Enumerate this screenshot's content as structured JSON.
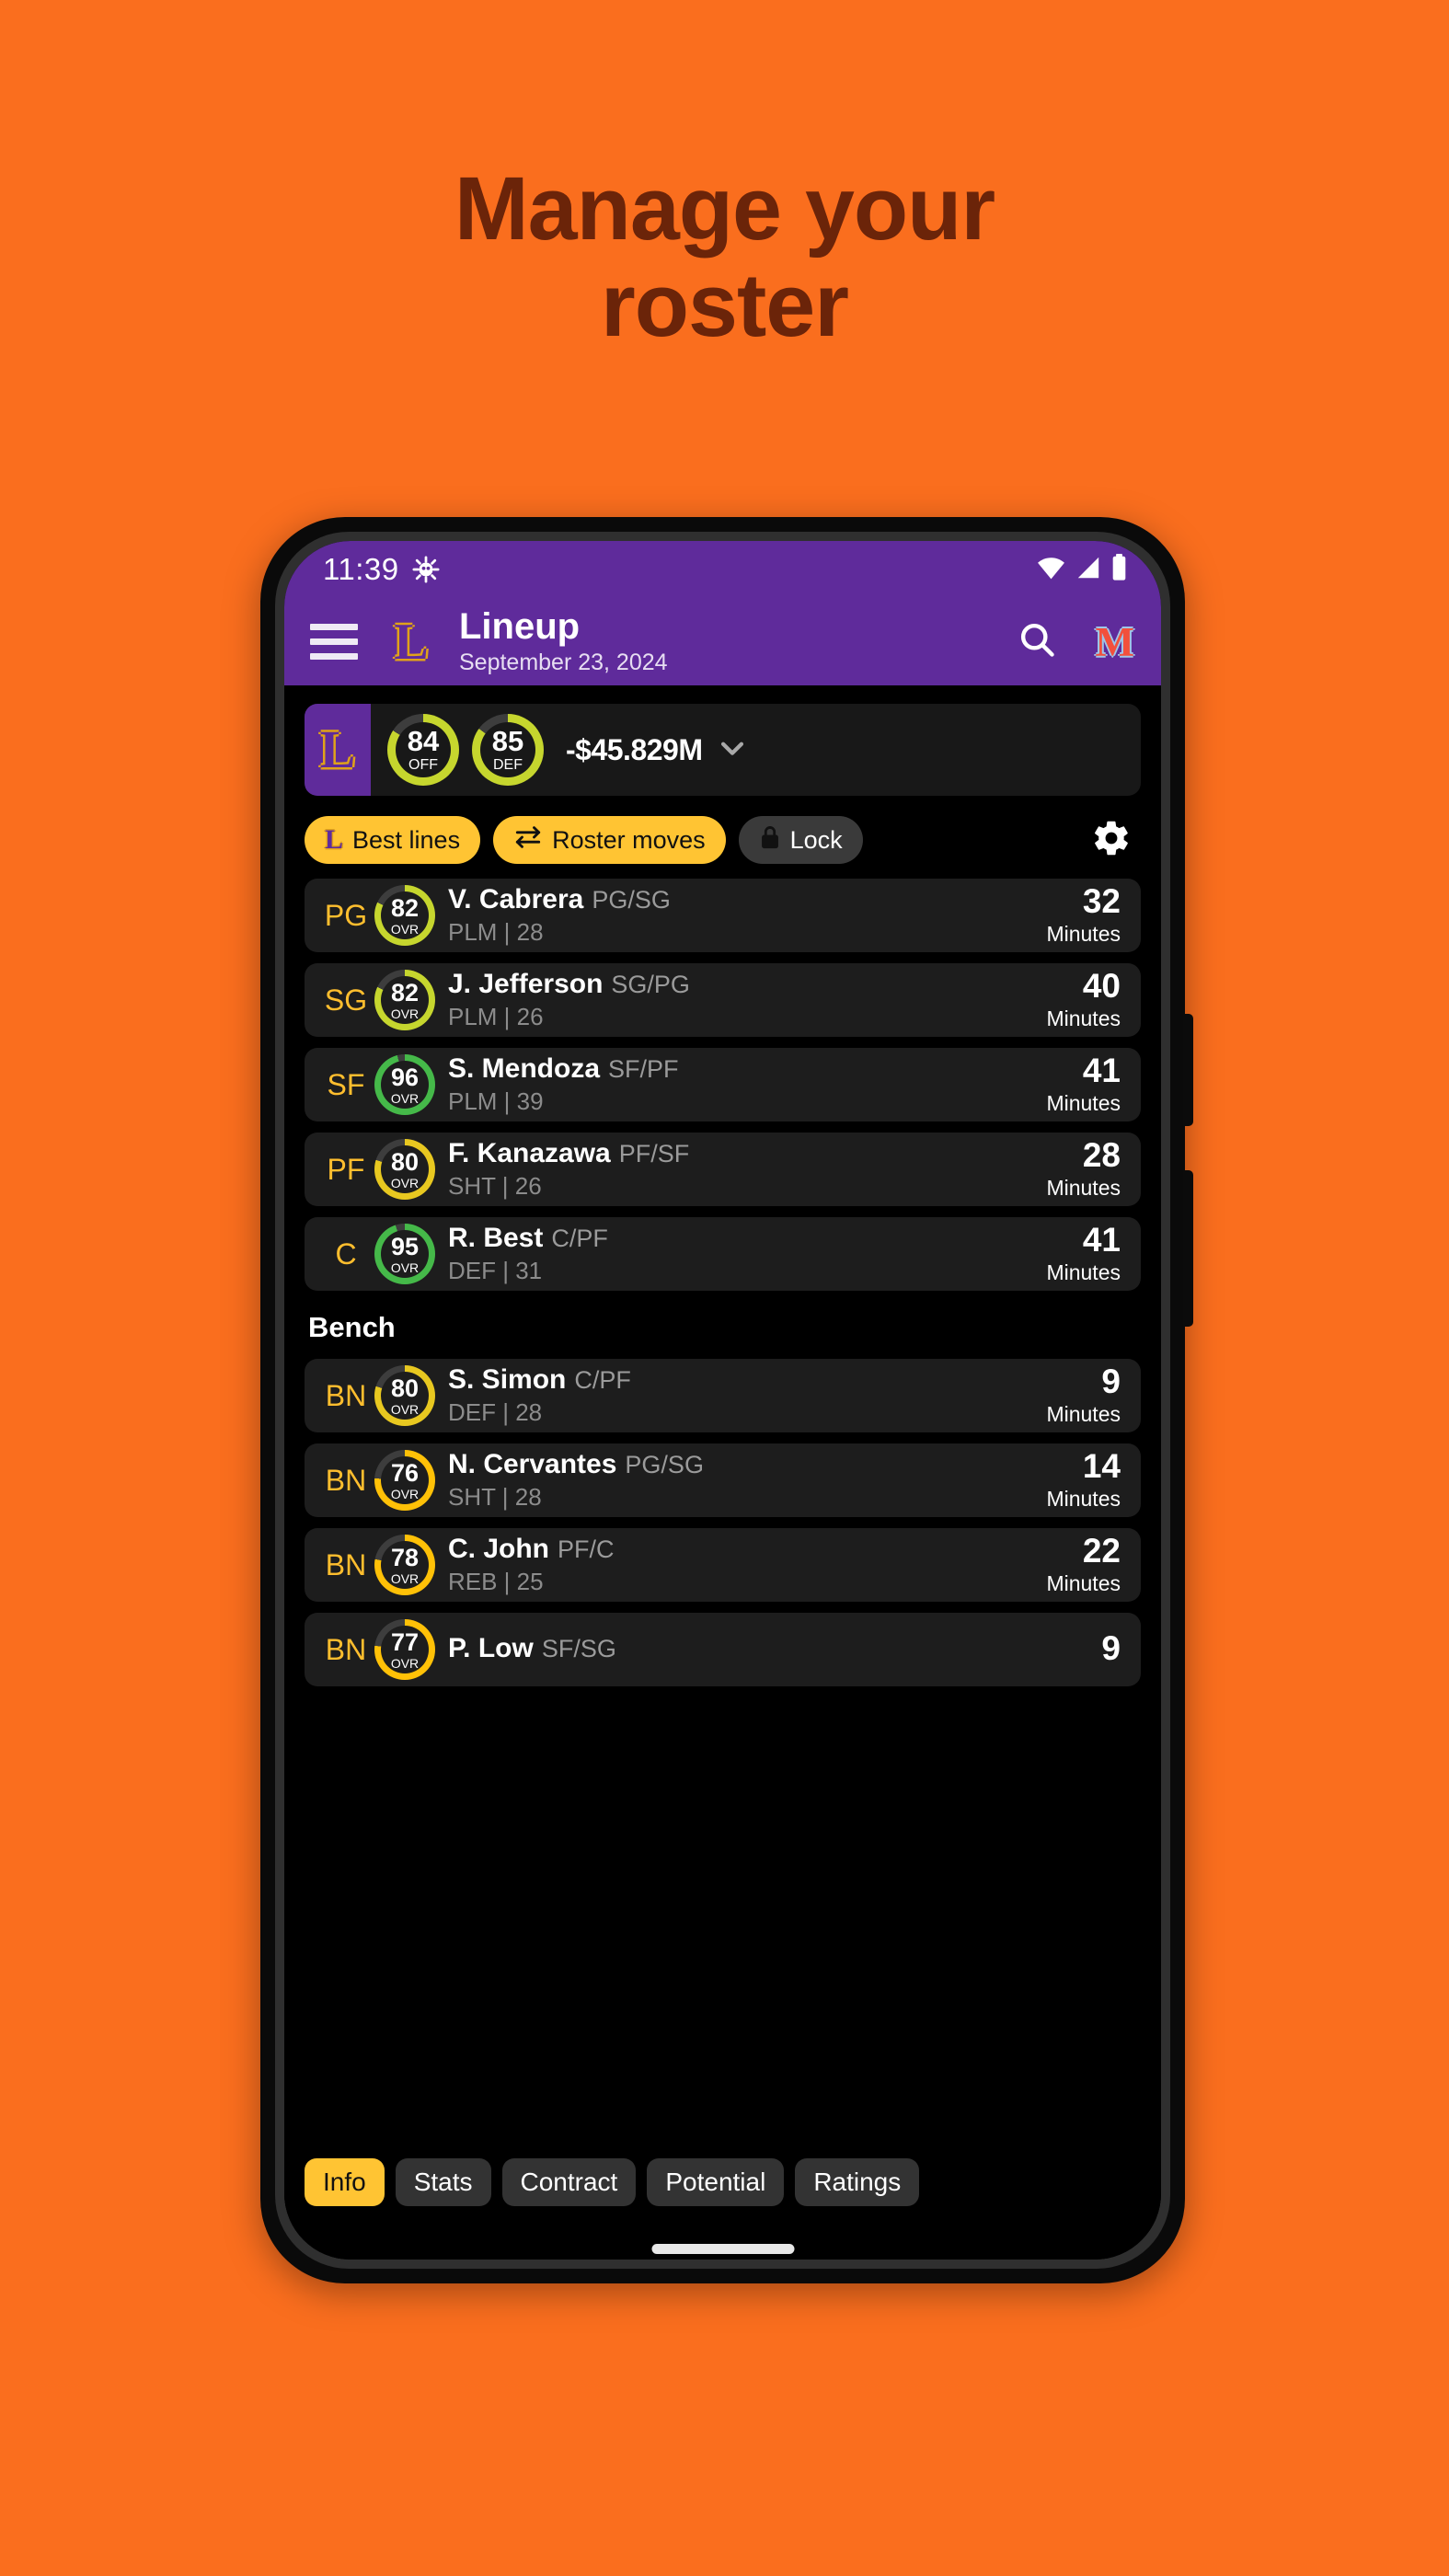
{
  "promo": {
    "headline_line1": "Manage your",
    "headline_line2": "roster",
    "bg_color": "#fa6e1e",
    "text_color": "#6b2409"
  },
  "status_bar": {
    "time": "11:39",
    "icons": [
      "bug-icon",
      "wifi-icon",
      "cellular-signal-icon",
      "battery-icon"
    ]
  },
  "app_bar": {
    "menu_icon": "hamburger-menu-icon",
    "team_logo": "L",
    "title": "Lineup",
    "subtitle": "September 23, 2024",
    "search_icon": "search-icon",
    "right_logo": "M",
    "bg_color": "#5f2b9b"
  },
  "team_card": {
    "logo": "L",
    "ratings": [
      {
        "value": "84",
        "label": "OFF",
        "pct": 84,
        "color": "#c6d62e"
      },
      {
        "value": "85",
        "label": "DEF",
        "pct": 85,
        "color": "#c6d62e"
      }
    ],
    "cap_space": "-$45.829M",
    "expand_icon": "chevron-down-icon"
  },
  "actions": [
    {
      "label": "Best lines",
      "icon": "team-l-icon",
      "style": "amber"
    },
    {
      "label": "Roster moves",
      "icon": "swap-arrows-icon",
      "style": "amber"
    },
    {
      "label": "Lock",
      "icon": "lock-icon",
      "style": "dark"
    }
  ],
  "settings_icon": "gear-icon",
  "starters": [
    {
      "pos": "PG",
      "ovr": "82",
      "ovr_pct": 82,
      "ring_color": "#c6d62e",
      "name": "V. Cabrera",
      "positions": "PG/SG",
      "trait": "PLM",
      "age": "28",
      "minutes": "32",
      "minutes_label": "Minutes"
    },
    {
      "pos": "SG",
      "ovr": "82",
      "ovr_pct": 82,
      "ring_color": "#c6d62e",
      "name": "J. Jefferson",
      "positions": "SG/PG",
      "trait": "PLM",
      "age": "26",
      "minutes": "40",
      "minutes_label": "Minutes"
    },
    {
      "pos": "SF",
      "ovr": "96",
      "ovr_pct": 96,
      "ring_color": "#45b949",
      "name": "S. Mendoza",
      "positions": "SF/PF",
      "trait": "PLM",
      "age": "39",
      "minutes": "41",
      "minutes_label": "Minutes"
    },
    {
      "pos": "PF",
      "ovr": "80",
      "ovr_pct": 80,
      "ring_color": "#e8c820",
      "name": "F. Kanazawa",
      "positions": "PF/SF",
      "trait": "SHT",
      "age": "26",
      "minutes": "28",
      "minutes_label": "Minutes"
    },
    {
      "pos": "C",
      "ovr": "95",
      "ovr_pct": 95,
      "ring_color": "#45b949",
      "name": "R. Best",
      "positions": "C/PF",
      "trait": "DEF",
      "age": "31",
      "minutes": "41",
      "minutes_label": "Minutes"
    }
  ],
  "bench_header": "Bench",
  "bench": [
    {
      "pos": "BN",
      "ovr": "80",
      "ovr_pct": 80,
      "ring_color": "#e8c820",
      "name": "S. Simon",
      "positions": "C/PF",
      "trait": "DEF",
      "age": "28",
      "minutes": "9",
      "minutes_label": "Minutes"
    },
    {
      "pos": "BN",
      "ovr": "76",
      "ovr_pct": 76,
      "ring_color": "#ffc107",
      "name": "N. Cervantes",
      "positions": "PG/SG",
      "trait": "SHT",
      "age": "28",
      "minutes": "14",
      "minutes_label": "Minutes"
    },
    {
      "pos": "BN",
      "ovr": "78",
      "ovr_pct": 78,
      "ring_color": "#ffc107",
      "name": "C. John",
      "positions": "PF/C",
      "trait": "REB",
      "age": "25",
      "minutes": "22",
      "minutes_label": "Minutes"
    },
    {
      "pos": "BN",
      "ovr": "77",
      "ovr_pct": 77,
      "ring_color": "#ffc107",
      "name": "P. Low",
      "positions": "SF/SG",
      "trait": "",
      "age": "",
      "minutes": "9",
      "minutes_label": ""
    }
  ],
  "tabs": [
    {
      "label": "Info",
      "active": true
    },
    {
      "label": "Stats",
      "active": false
    },
    {
      "label": "Contract",
      "active": false
    },
    {
      "label": "Potential",
      "active": false
    },
    {
      "label": "Ratings",
      "active": false
    }
  ]
}
